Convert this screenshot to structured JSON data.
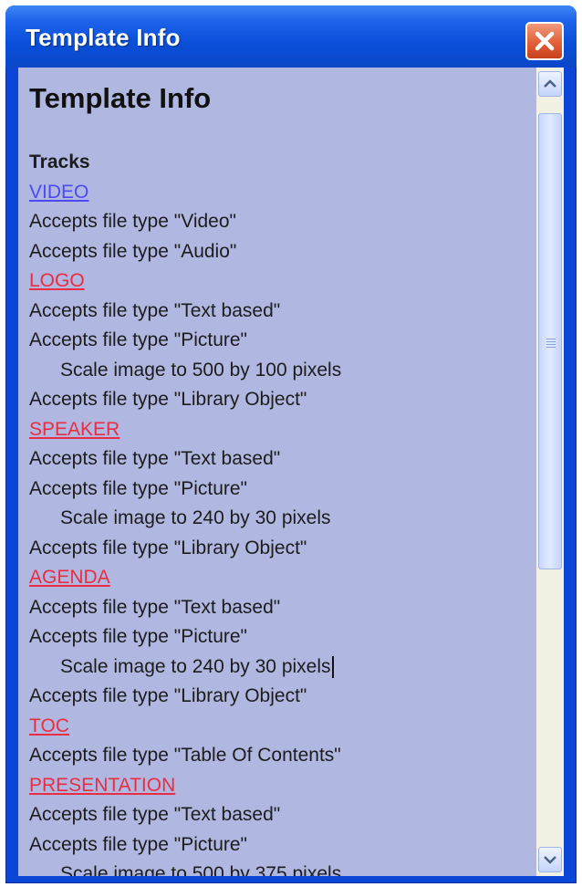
{
  "window": {
    "title": "Template Info"
  },
  "document": {
    "title": "Template Info",
    "lines": [
      {
        "type": "heading",
        "text": "Tracks"
      },
      {
        "type": "link",
        "text": "VIDEO",
        "visited": true
      },
      {
        "type": "text",
        "text": "Accepts file type \"Video\""
      },
      {
        "type": "text",
        "text": "Accepts file type \"Audio\""
      },
      {
        "type": "link",
        "text": "LOGO"
      },
      {
        "type": "text",
        "text": "Accepts file type \"Text based\""
      },
      {
        "type": "text",
        "text": "Accepts file type \"Picture\""
      },
      {
        "type": "indent",
        "text": "Scale image to 500 by 100 pixels"
      },
      {
        "type": "text",
        "text": "Accepts file type \"Library Object\""
      },
      {
        "type": "link",
        "text": "SPEAKER"
      },
      {
        "type": "text",
        "text": "Accepts file type \"Text based\""
      },
      {
        "type": "text",
        "text": "Accepts file type \"Picture\""
      },
      {
        "type": "indent",
        "text": "Scale image to 240 by 30 pixels"
      },
      {
        "type": "text",
        "text": "Accepts file type \"Library Object\""
      },
      {
        "type": "link",
        "text": "AGENDA"
      },
      {
        "type": "text",
        "text": "Accepts file type \"Text based\""
      },
      {
        "type": "text",
        "text": "Accepts file type \"Picture\""
      },
      {
        "type": "indent",
        "text": "Scale image to 240 by 30 pixels",
        "caret": true
      },
      {
        "type": "text",
        "text": "Accepts file type \"Library Object\""
      },
      {
        "type": "link",
        "text": "TOC"
      },
      {
        "type": "text",
        "text": "Accepts file type \"Table Of Contents\""
      },
      {
        "type": "link",
        "text": "PRESENTATION"
      },
      {
        "type": "text",
        "text": "Accepts file type \"Text based\""
      },
      {
        "type": "text",
        "text": "Accepts file type \"Picture\""
      },
      {
        "type": "indent",
        "text": "Scale image to 500 by 375 pixels"
      }
    ]
  },
  "colors": {
    "title_bar": "#0b4fd9",
    "content_background": "#b0b8e2",
    "link_unvisited": "#ea2d40",
    "link_visited": "#4a4af0"
  },
  "icons": {
    "close": "close-icon",
    "scroll_up": "chevron-up-icon",
    "scroll_down": "chevron-down-icon"
  }
}
